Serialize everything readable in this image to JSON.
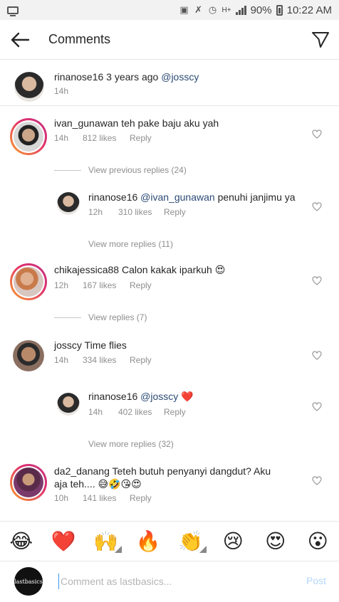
{
  "status_bar": {
    "battery": "90%",
    "time": "10:22 AM",
    "network": "H+"
  },
  "header": {
    "title": "Comments",
    "back_icon": "arrow-left-icon",
    "send_icon": "paper-plane-icon"
  },
  "caption": {
    "username": "rinanose16",
    "text": "3 years ago",
    "mention": "@josscy",
    "time": "14h"
  },
  "comments": [
    {
      "username": "ivan_gunawan",
      "text": "teh pake baju aku yah",
      "time": "14h",
      "likes": "812 likes",
      "reply": "Reply",
      "replies_link": "View previous replies (24)"
    },
    {
      "username": "rinanose16",
      "mention": "@ivan_gunawan",
      "text": "penuhi janjimu ya",
      "time": "12h",
      "likes": "310 likes",
      "reply": "Reply",
      "replies_link": "View more replies (11)"
    },
    {
      "username": "chikajessica88",
      "text": "Calon kakak iparkuh",
      "emoji": "😍",
      "time": "12h",
      "likes": "167 likes",
      "reply": "Reply",
      "replies_link": "View replies (7)"
    },
    {
      "username": "josscy",
      "text": "Time flies",
      "time": "14h",
      "likes": "334 likes",
      "reply": "Reply"
    },
    {
      "username": "rinanose16",
      "mention": "@josscy",
      "emoji": "❤️",
      "time": "14h",
      "likes": "402 likes",
      "reply": "Reply",
      "replies_link": "View more replies (32)"
    },
    {
      "username": "da2_danang",
      "text": "Teteh butuh penyanyi dangdut? Aku",
      "text2": "aja teh....",
      "emoji": "😅🤣😘😍",
      "time": "10h",
      "likes": "141 likes",
      "reply": "Reply"
    }
  ],
  "emoji_bar": [
    "😂",
    "❤️",
    "🙌",
    "🔥",
    "👏",
    "😢",
    "😍",
    "😮"
  ],
  "composer": {
    "avatar_text": "lastbasics",
    "placeholder": "Comment as lastbasics...",
    "post_label": "Post"
  },
  "colors": {
    "mention": "#2b4a75",
    "post_disabled": "#b3d7fb",
    "meta": "#8e8e8e"
  }
}
